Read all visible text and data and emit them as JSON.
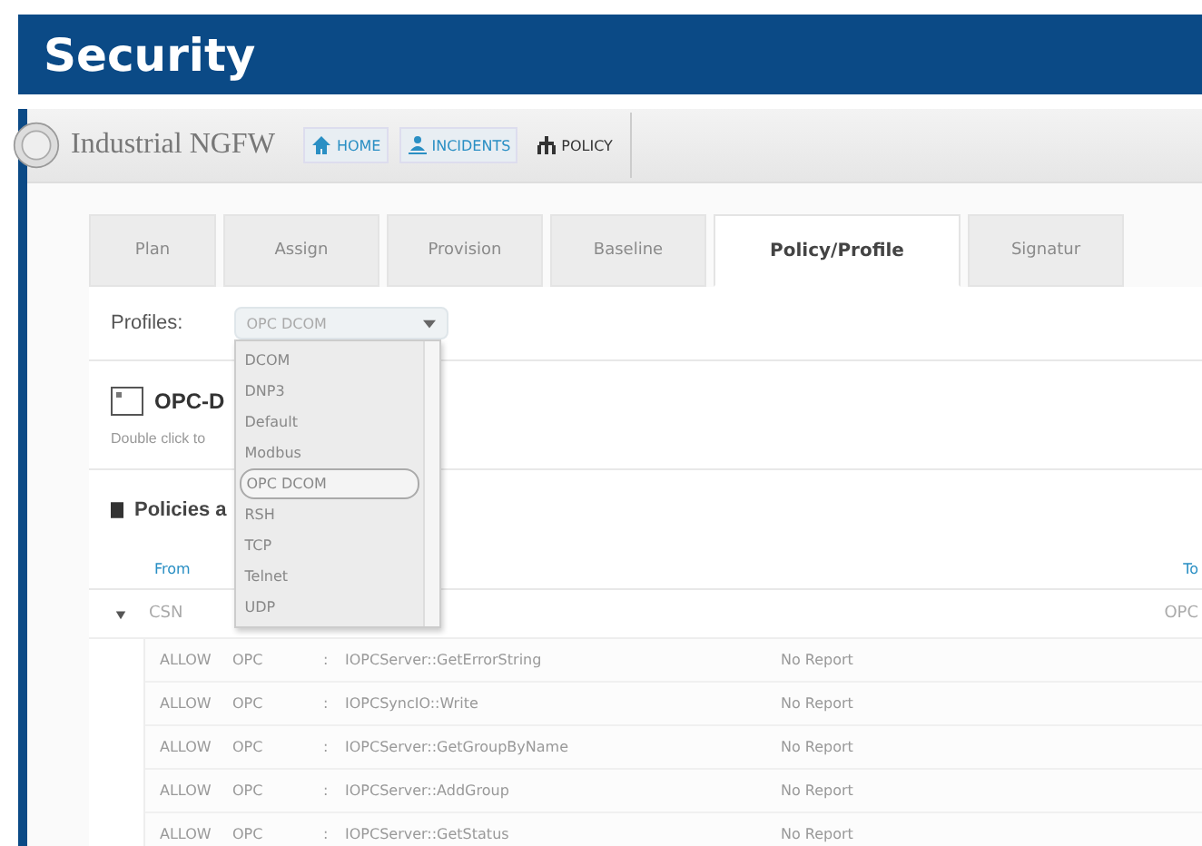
{
  "banner": {
    "title": "Security"
  },
  "app": {
    "name": "Industrial NGFW",
    "nav": [
      {
        "label": "HOME",
        "selected": false
      },
      {
        "label": "INCIDENTS",
        "selected": false
      },
      {
        "label": "POLICY",
        "selected": true
      }
    ]
  },
  "tabs": [
    {
      "label": "Plan",
      "selected": false
    },
    {
      "label": "Assign",
      "selected": false
    },
    {
      "label": "Provision",
      "selected": false
    },
    {
      "label": "Baseline",
      "selected": false
    },
    {
      "label": "Policy/Profile",
      "selected": true
    },
    {
      "label": "Signatur",
      "selected": false
    }
  ],
  "profiles": {
    "label": "Profiles:",
    "value": "OPC DCOM",
    "options": [
      {
        "label": "DCOM",
        "selected": false
      },
      {
        "label": "DNP3",
        "selected": false
      },
      {
        "label": "Default",
        "selected": false
      },
      {
        "label": "Modbus",
        "selected": false
      },
      {
        "label": "OPC DCOM",
        "selected": true
      },
      {
        "label": "RSH",
        "selected": false
      },
      {
        "label": "TCP",
        "selected": false
      },
      {
        "label": "Telnet",
        "selected": false
      },
      {
        "label": "UDP",
        "selected": false
      }
    ]
  },
  "profile_heading": {
    "title": "OPC-D",
    "hint": "Double click to"
  },
  "policies": {
    "title": "Policies a",
    "columns": [
      "From",
      "To"
    ],
    "group": {
      "from": "CSN",
      "to": "OPC",
      "expanded": true
    },
    "rows": [
      {
        "action": "ALLOW",
        "protocol": "OPC",
        "separator": ":",
        "method": "IOPCServer::GetErrorString",
        "report": "No Report"
      },
      {
        "action": "ALLOW",
        "protocol": "OPC",
        "separator": ":",
        "method": "IOPCSyncIO::Write",
        "report": "No Report"
      },
      {
        "action": "ALLOW",
        "protocol": "OPC",
        "separator": ":",
        "method": "IOPCServer::GetGroupByName",
        "report": "No Report"
      },
      {
        "action": "ALLOW",
        "protocol": "OPC",
        "separator": ":",
        "method": "IOPCServer::AddGroup",
        "report": "No Report"
      },
      {
        "action": "ALLOW",
        "protocol": "OPC",
        "separator": ":",
        "method": "IOPCServer::GetStatus",
        "report": "No Report"
      }
    ]
  }
}
